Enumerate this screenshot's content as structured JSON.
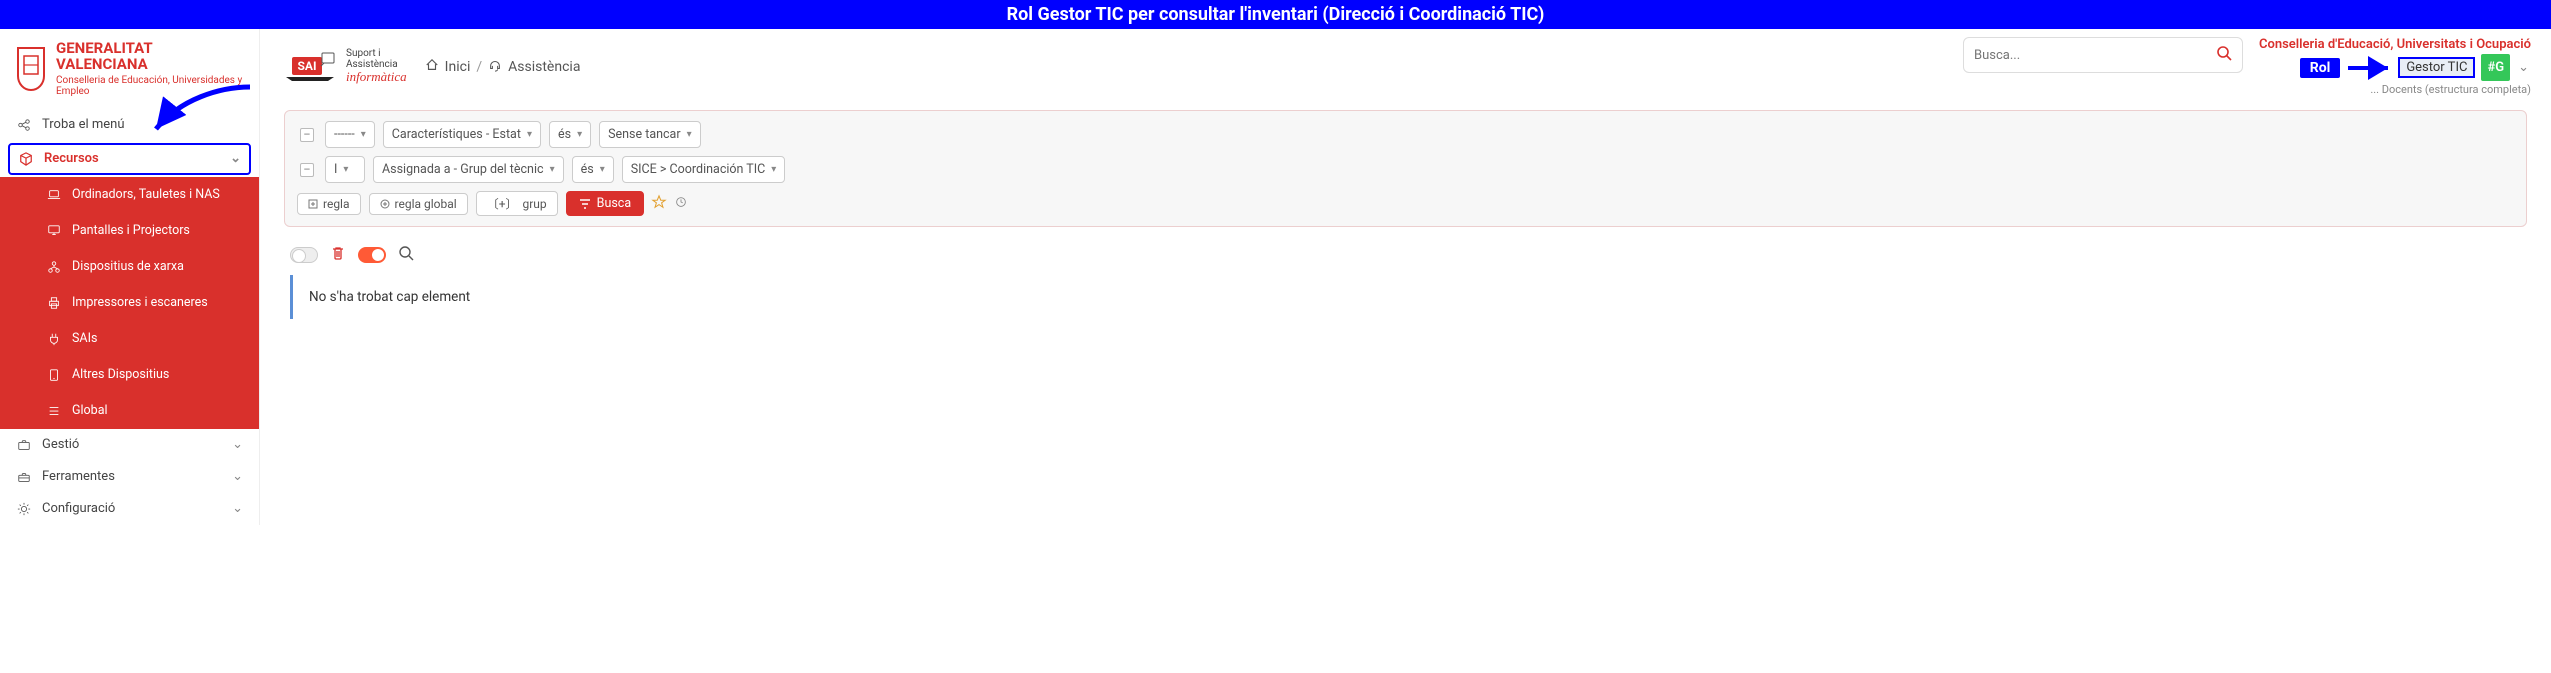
{
  "banner": "Rol Gestor TIC  per consultar l'inventari (Direcció i Coordinació TIC)",
  "gv": {
    "line1": "GENERALITAT",
    "line2": "VALENCIANA",
    "sub": "Conselleria de Educación,\nUniversidades y Empleo"
  },
  "sidebar": {
    "find": "Troba el menú",
    "recursos": "Recursos",
    "sub": {
      "ordinadors": "Ordinadors, Tauletes i NAS",
      "pantalles": "Pantalles i Projectors",
      "xarxa": "Dispositius de xarxa",
      "impressores": "Impressores i escaneres",
      "sais": "SAIs",
      "altres": "Altres Dispositius",
      "global": "Global"
    },
    "gestio": "Gestió",
    "ferramentes": "Ferramentes",
    "configuracio": "Configuració"
  },
  "sai": {
    "l1": "Suport i",
    "l2": "Assistència",
    "l3": "informàtica"
  },
  "breadcrumb": {
    "home": "Inici",
    "current": "Assistència"
  },
  "search": {
    "placeholder": "Busca..."
  },
  "org": {
    "line1": "Conselleria d'Educació, Universitats i Ocupació",
    "rol": "Rol",
    "gestor": "Gestor TIC",
    "hg": "#G",
    "line3": "... Docents (estructura completa)"
  },
  "filters": {
    "row1": {
      "a": "------",
      "b": "Característiques - Estat",
      "c": "és",
      "d": "Sense tancar"
    },
    "row2": {
      "a": "I",
      "b": "Assignada a - Grup del tècnic",
      "c": "és",
      "d": "SICE > Coordinación TIC"
    },
    "btn_regla": "regla",
    "btn_regla_global": "regla global",
    "btn_grup": "grup",
    "btn_busca": "Busca"
  },
  "results": {
    "empty": "No s'ha trobat cap element"
  }
}
